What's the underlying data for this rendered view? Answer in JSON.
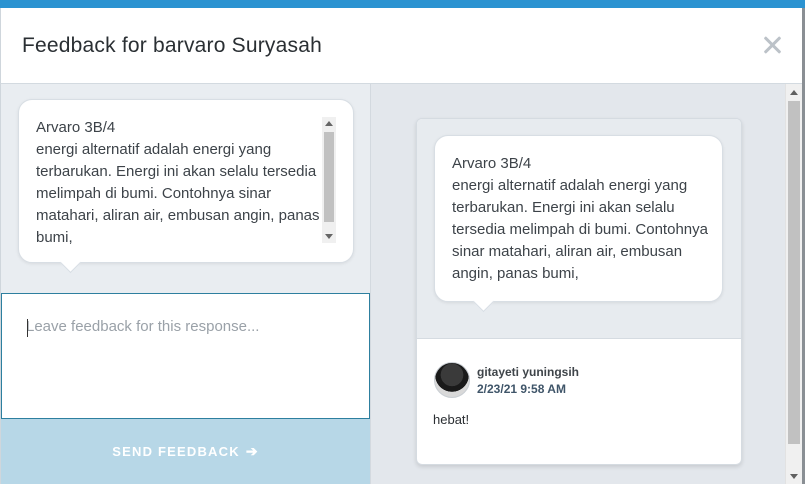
{
  "modal": {
    "title": "Feedback for barvaro Suryasah"
  },
  "response": {
    "text": "Arvaro 3B/4\nenergi alternatif adalah energi yang terbarukan. Energi ini akan selalu tersedia melimpah di bumi. Contohnya sinar matahari, aliran air, embusan angin, panas bumi,"
  },
  "feedback_input": {
    "placeholder": "Leave feedback for this response..."
  },
  "send_button": {
    "label": "SEND FEEDBACK",
    "arrow": "➔"
  },
  "feedback_thread": {
    "response_text": "Arvaro 3B/4\nenergi alternatif adalah energi yang terbarukan. Energi ini akan selalu tersedia melimpah di bumi. Contohnya sinar matahari, aliran air, embusan angin, panas bumi,",
    "author": "gitayeti yuningsih",
    "timestamp": "2/23/21 9:58 AM",
    "comment": "hebat!"
  },
  "colors": {
    "accent": "#2b93d1",
    "send_button_bg": "#b7d7e7",
    "panel_bg": "#e9edf1"
  },
  "icons": {
    "close": "close-icon",
    "send_arrow": "arrow-right-icon"
  }
}
